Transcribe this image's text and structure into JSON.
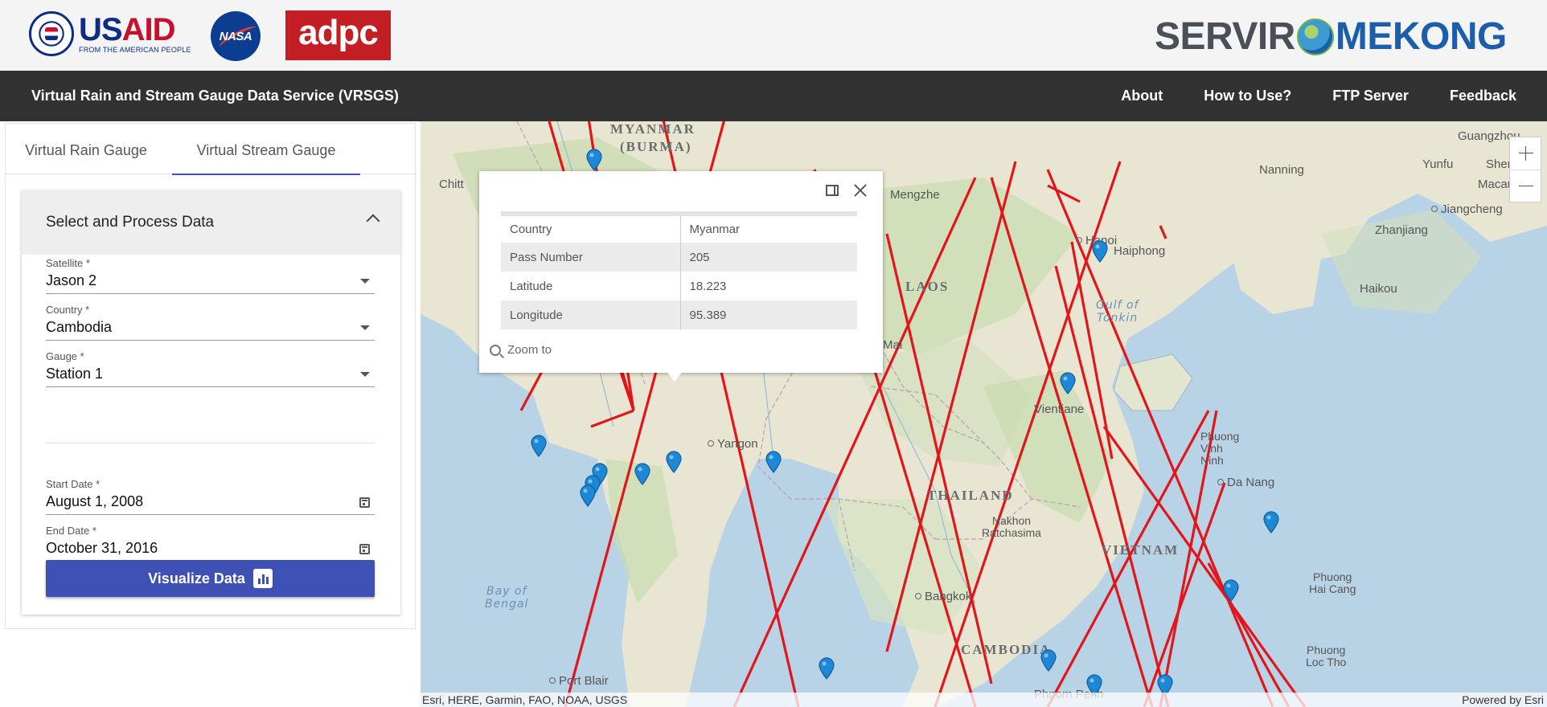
{
  "header": {
    "usaid_us": "US",
    "usaid_aid": "AID",
    "usaid_tagline": "FROM THE AMERICAN PEOPLE",
    "nasa_text": "NASA",
    "adpc_text": "adpc",
    "servir_left": "SERVIR",
    "servir_right": "MEKONG"
  },
  "nav": {
    "title": "Virtual Rain and Stream Gauge Data Service (VRSGS)",
    "links": [
      "About",
      "How to Use?",
      "FTP Server",
      "Feedback"
    ]
  },
  "tabs": [
    "Virtual Rain Gauge",
    "Virtual Stream Gauge"
  ],
  "card": {
    "title": "Select and Process Data",
    "fields": [
      {
        "label": "Satellite *",
        "value": "Jason 2",
        "icon": "chevron-down-icon"
      },
      {
        "label": "Country *",
        "value": "Cambodia",
        "icon": "chevron-down-icon"
      },
      {
        "label": "Gauge *",
        "value": "Station 1",
        "icon": "chevron-down-icon"
      },
      {
        "label": "Start Date *",
        "value": "August 1, 2008",
        "icon": "calendar-icon"
      },
      {
        "label": "End Date *",
        "value": "October 31, 2016",
        "icon": "calendar-icon"
      }
    ],
    "button_label": "Visualize Data"
  },
  "map": {
    "labels": {
      "myanmar_1": "MYANMAR",
      "myanmar_2": "(BURMA)",
      "laos": "LAOS",
      "thailand": "THAILAND",
      "vietnam": "VIETNAM",
      "cambodia": "CAMBODIA",
      "guangzhou": "Guangzhou",
      "nanning": "Nanning",
      "yunfu": "Yunfu",
      "shenzhen": "Shen",
      "macau": "Macau",
      "jiangcheng": "Jiangcheng",
      "zhanjiang": "Zhanjiang",
      "mengzhe": "Mengzhe",
      "hanoi": "Hanoi",
      "haiphong": "Haiphong",
      "gulf_tonkin_1": "Gulf of",
      "gulf_tonkin_2": "Tonkin",
      "haikou": "Haikou",
      "chittagong": "Chitt",
      "mai": "Mai",
      "vientiane": "Vientiane",
      "yangon": "Yangon",
      "phuong_vinh_ninh": "Phuong\nVinh\nNinh",
      "da_nang": "Da Nang",
      "nakhon": "Nakhon\nRatchasima",
      "bangkok": "Bangkok",
      "bay_bengal_1": "Bay of",
      "bay_bengal_2": "Bengal",
      "phuong_hai_cang": "Phuong\nHai Cang",
      "phuong_loc_tho": "Phuong\nLoc Tho",
      "port_blair": "Port Blair",
      "phnom_penh": "Phnom Penh"
    },
    "attribution": "Esri, HERE, Garmin, FAO, NOAA, USGS",
    "powered_by": "Powered by Esri",
    "track_color": "#e3151a",
    "pin_color": "#1e88d6"
  },
  "popup": {
    "rows": [
      {
        "key": "Country",
        "value": "Myanmar"
      },
      {
        "key": "Pass Number",
        "value": "205"
      },
      {
        "key": "Latitude",
        "value": "18.223"
      },
      {
        "key": "Longitude",
        "value": "95.389"
      }
    ],
    "zoom_to": "Zoom to"
  }
}
